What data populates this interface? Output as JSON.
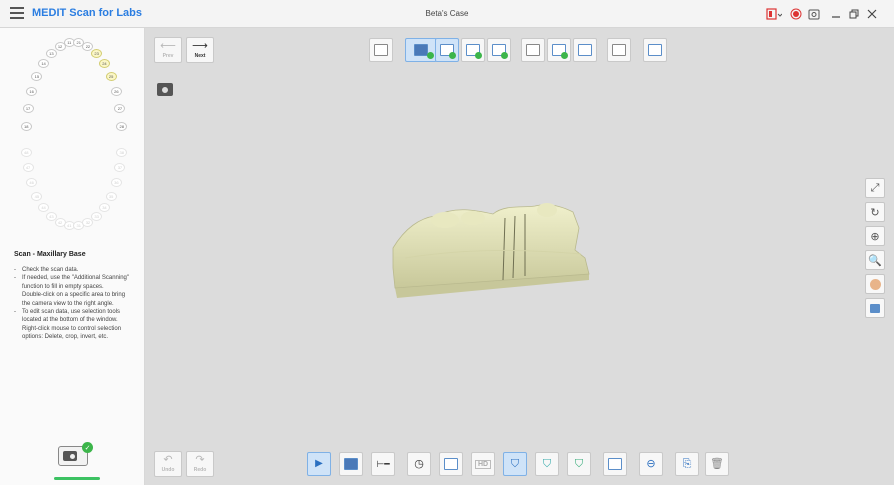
{
  "titlebar": {
    "app_title": "MEDIT Scan for Labs",
    "case_title": "Beta's Case"
  },
  "navigation": {
    "prev_label": "Prev",
    "next_label": "Next"
  },
  "tooth_chart": {
    "upper_teeth": [
      "18",
      "17",
      "16",
      "15",
      "14",
      "13",
      "12",
      "11",
      "21",
      "22",
      "23",
      "24",
      "25",
      "26",
      "27",
      "28"
    ],
    "lower_teeth": [
      "48",
      "47",
      "46",
      "45",
      "44",
      "43",
      "42",
      "41",
      "31",
      "32",
      "33",
      "34",
      "35",
      "36",
      "37",
      "38"
    ],
    "selected": [
      "23",
      "24",
      "25"
    ]
  },
  "step": {
    "title": "Scan - Maxillary Base",
    "instructions": [
      "Check the scan data.",
      "If needed, use the \"Additional Scanning\" function to fill in empty spaces.",
      "Double-click on a specific area to bring the camera view to the right angle.",
      "To edit scan data, use selection tools located at the bottom of the window.",
      "Right-click mouse to control selection options: Delete, crop, invert, etc."
    ]
  },
  "history": {
    "undo_label": "Undo",
    "redo_label": "Redo"
  },
  "bottom_toolbar": {
    "hd_label": "HD"
  },
  "colors": {
    "accent": "#2a7de1",
    "success": "#3cb54a",
    "model": "#e2e2b8",
    "background": "#dcdcdc"
  }
}
